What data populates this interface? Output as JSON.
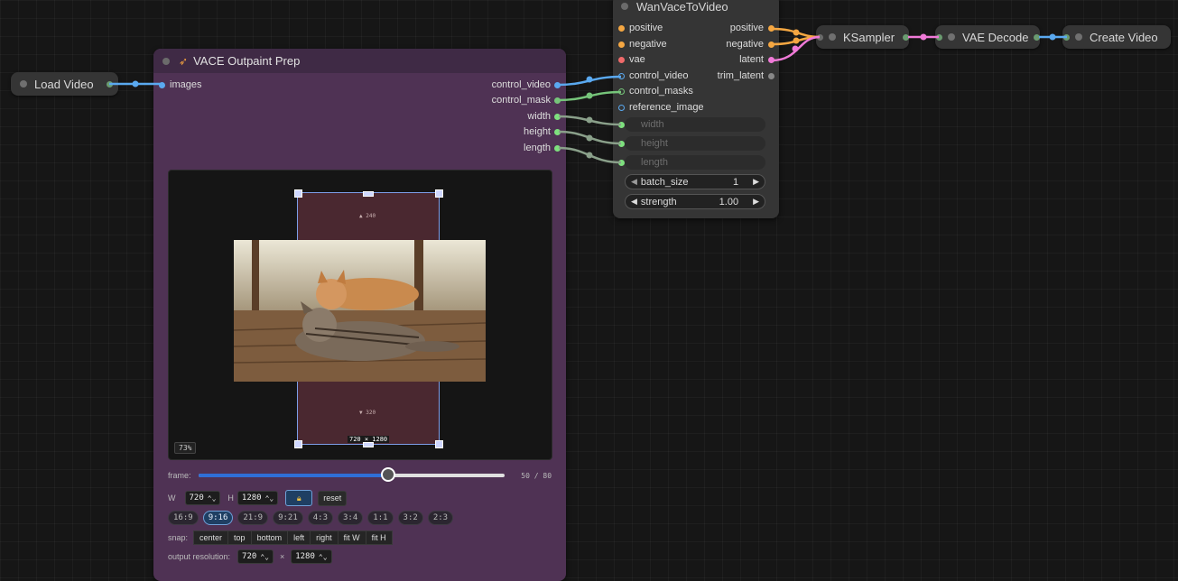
{
  "nodes": {
    "load_video": {
      "title": "Load Video"
    },
    "vace": {
      "title": "VACE Outpaint Prep",
      "input": "images",
      "outputs": [
        "control_video",
        "control_mask",
        "width",
        "height",
        "length"
      ],
      "preview": {
        "top_pad": "▲ 240",
        "bottom_pad": "▼ 320",
        "out_size": "720 × 1280",
        "zoom": "73%"
      },
      "frame": {
        "label": "frame:",
        "readout": "50 / 80",
        "value": 50,
        "max": 80
      },
      "dims": {
        "w_label": "W",
        "w_value": "720",
        "h_label": "H",
        "h_value": "1280",
        "reset": "reset"
      },
      "ratios": [
        "16:9",
        "9:16",
        "21:9",
        "9:21",
        "4:3",
        "3:4",
        "1:1",
        "3:2",
        "2:3"
      ],
      "active_ratio": "9:16",
      "snap": {
        "label": "snap:",
        "buttons": [
          "center",
          "top",
          "bottom",
          "left",
          "right",
          "fit W",
          "fit H"
        ]
      },
      "output_resolution": {
        "label": "output resolution:",
        "w": "720",
        "sep": "×",
        "h": "1280"
      }
    },
    "wan": {
      "title": "WanVaceToVideo",
      "inputs": [
        "positive",
        "negative",
        "vae",
        "control_video",
        "control_masks",
        "reference_image"
      ],
      "outputs": [
        "positive",
        "negative",
        "latent",
        "trim_latent"
      ],
      "fields": [
        "width",
        "height",
        "length"
      ],
      "widgets": [
        {
          "name": "batch_size",
          "value": "1"
        },
        {
          "name": "strength",
          "value": "1.00"
        }
      ]
    },
    "ksampler": {
      "title": "KSampler"
    },
    "vae_decode": {
      "title": "VAE Decode"
    },
    "create_video": {
      "title": "Create Video"
    }
  },
  "colors": {
    "image_wire": "#5aa9f0",
    "mask_wire": "#76c57a",
    "int_wire": "#8aa88a",
    "cond_wire": "#f5a742",
    "latent_wire": "#f07ad8",
    "vace_body": "#4f3254"
  }
}
